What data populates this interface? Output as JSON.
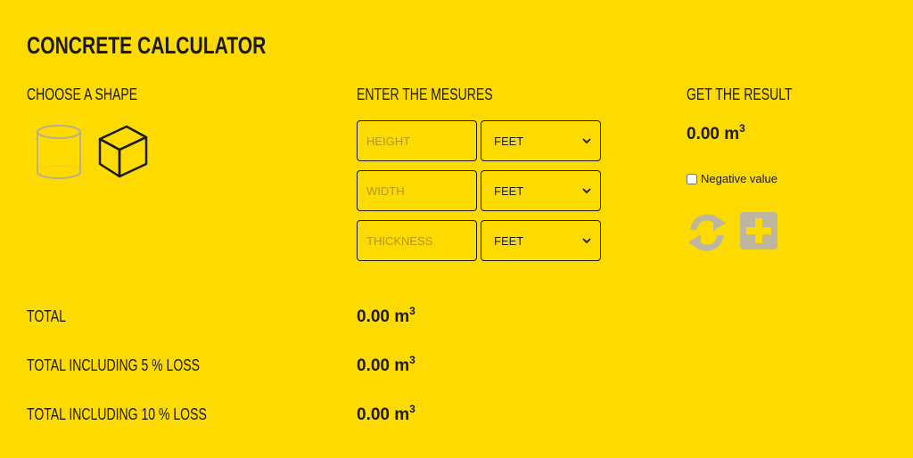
{
  "title": "CONCRETE CALCULATOR",
  "sections": {
    "shape": "CHOOSE A SHAPE",
    "mesures": "ENTER THE MESURES",
    "result": "GET THE RESULT"
  },
  "shapes": [
    {
      "name": "cylinder-icon",
      "color": "#B9B08A"
    },
    {
      "name": "cube-icon",
      "color": "#1a1a1a"
    }
  ],
  "fields": [
    {
      "placeholder": "HEIGHT",
      "unit": "FEET"
    },
    {
      "placeholder": "WIDTH",
      "unit": "FEET"
    },
    {
      "placeholder": "THICKNESS",
      "unit": "FEET"
    }
  ],
  "result": {
    "value": "0.00 m",
    "unit_sup": "3",
    "negative_label": "Negative value"
  },
  "actions": {
    "refresh_icon": "refresh-icon",
    "add_icon": "plus-icon",
    "color": "#BDB6A0"
  },
  "totals": [
    {
      "label": "TOTAL",
      "value": "0.00 m",
      "sup": "3"
    },
    {
      "label": "TOTAL INCLUDING 5 % LOSS",
      "value": "0.00 m",
      "sup": "3"
    },
    {
      "label": "TOTAL INCLUDING 10 % LOSS",
      "value": "0.00 m",
      "sup": "3"
    }
  ],
  "colors": {
    "background": "#FDDA00",
    "text": "#1a1a1a"
  }
}
